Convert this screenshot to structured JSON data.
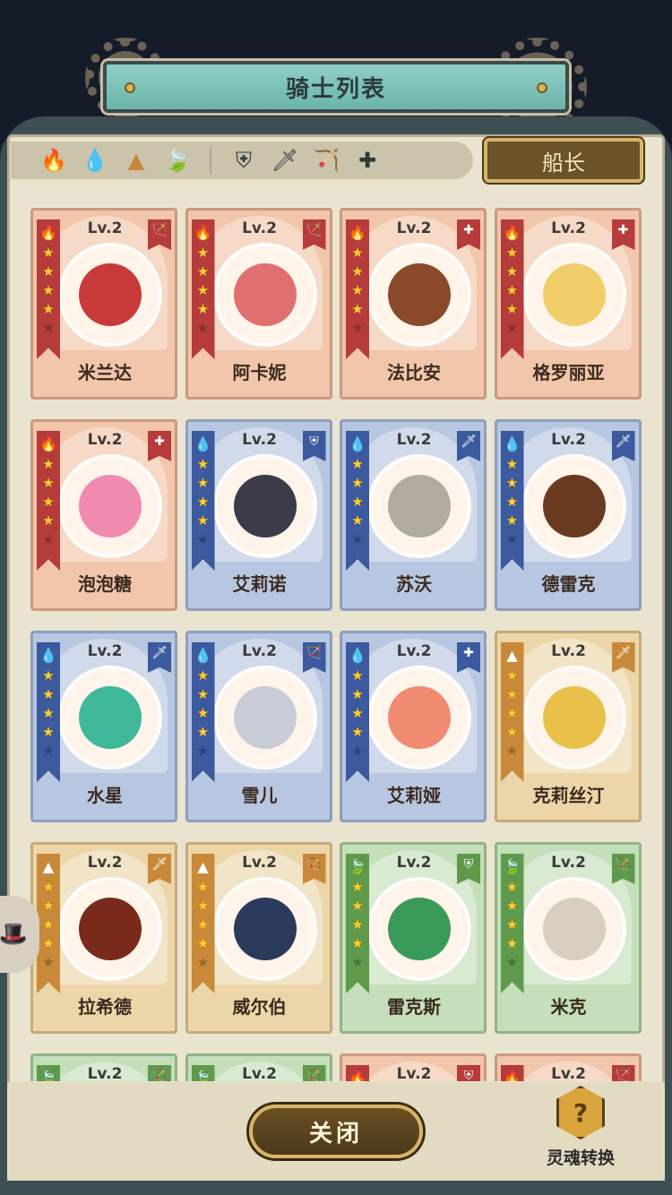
{
  "window": {
    "title": "骑士列表"
  },
  "filters": {
    "elements": [
      {
        "name": "fire",
        "glyph": "🔥",
        "color": "#c23a3a"
      },
      {
        "name": "water",
        "glyph": "💧",
        "color": "#3d5a9e"
      },
      {
        "name": "earth",
        "glyph": "▲",
        "color": "#c88a3a"
      },
      {
        "name": "wind",
        "glyph": "🍃",
        "color": "#5f9a4c"
      }
    ],
    "classes": [
      {
        "name": "shield",
        "glyph": "⛨"
      },
      {
        "name": "sword",
        "glyph": "🗡"
      },
      {
        "name": "bow",
        "glyph": "🏹"
      },
      {
        "name": "cross",
        "glyph": "✚"
      }
    ]
  },
  "captain_button": {
    "label": "船长"
  },
  "cards": [
    {
      "name": "米兰达",
      "level": "Lv.2",
      "element": "fire",
      "class": "bow",
      "stars": 4,
      "face": "#c83a3a"
    },
    {
      "name": "阿卡妮",
      "level": "Lv.2",
      "element": "fire",
      "class": "bow",
      "stars": 4,
      "face": "#e07070"
    },
    {
      "name": "法比安",
      "level": "Lv.2",
      "element": "fire",
      "class": "cross",
      "stars": 4,
      "face": "#8a4a2a"
    },
    {
      "name": "格罗丽亚",
      "level": "Lv.2",
      "element": "fire",
      "class": "cross",
      "stars": 4,
      "face": "#f0cf6a"
    },
    {
      "name": "泡泡糖",
      "level": "Lv.2",
      "element": "fire",
      "class": "cross",
      "stars": 4,
      "face": "#f08ab0"
    },
    {
      "name": "艾莉诺",
      "level": "Lv.2",
      "element": "water",
      "class": "shield",
      "stars": 4,
      "face": "#3b3b4a"
    },
    {
      "name": "苏沃",
      "level": "Lv.2",
      "element": "water",
      "class": "sword",
      "stars": 4,
      "face": "#b0aaa0"
    },
    {
      "name": "德雷克",
      "level": "Lv.2",
      "element": "water",
      "class": "sword",
      "stars": 4,
      "face": "#6a3a20"
    },
    {
      "name": "水星",
      "level": "Lv.2",
      "element": "water",
      "class": "sword",
      "stars": 4,
      "face": "#3fb89a"
    },
    {
      "name": "雪儿",
      "level": "Lv.2",
      "element": "water",
      "class": "bow",
      "stars": 4,
      "face": "#c8ccd6"
    },
    {
      "name": "艾莉娅",
      "level": "Lv.2",
      "element": "water",
      "class": "cross",
      "stars": 4,
      "face": "#f08a70"
    },
    {
      "name": "克莉丝汀",
      "level": "Lv.2",
      "element": "earth",
      "class": "sword",
      "stars": 4,
      "face": "#e8c04a"
    },
    {
      "name": "拉希德",
      "level": "Lv.2",
      "element": "earth",
      "class": "sword",
      "stars": 4,
      "face": "#7a2a1a"
    },
    {
      "name": "威尔伯",
      "level": "Lv.2",
      "element": "earth",
      "class": "bow",
      "stars": 4,
      "face": "#2a3a5a"
    },
    {
      "name": "雷克斯",
      "level": "Lv.2",
      "element": "wind",
      "class": "shield",
      "stars": 4,
      "face": "#3a9a5a"
    },
    {
      "name": "米克",
      "level": "Lv.2",
      "element": "wind",
      "class": "bow",
      "stars": 4,
      "face": "#d8cfc0"
    },
    {
      "name": "",
      "level": "Lv.2",
      "element": "wind",
      "class": "bow",
      "stars": 4,
      "face": "#c4dfb9"
    },
    {
      "name": "",
      "level": "Lv.2",
      "element": "wind",
      "class": "bow",
      "stars": 4,
      "face": "#c4dfb9"
    },
    {
      "name": "",
      "level": "Lv.2",
      "element": "fire",
      "class": "shield",
      "stars": 4,
      "face": "#f2c6aa"
    },
    {
      "name": "",
      "level": "Lv.2",
      "element": "fire",
      "class": "bow",
      "stars": 4,
      "face": "#f2c6aa"
    }
  ],
  "close_button": {
    "label": "关闭"
  },
  "soul_convert": {
    "label": "灵魂转换",
    "glyph": "?"
  }
}
